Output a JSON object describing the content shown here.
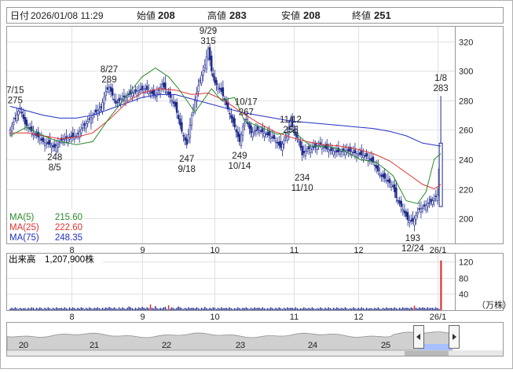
{
  "header": {
    "date_label": "日付",
    "date": "2026/01/08 11:29",
    "open_label": "始値",
    "open": "208",
    "high_label": "高値",
    "high": "283",
    "low_label": "安値",
    "low": "208",
    "close_label": "終値",
    "close": "251"
  },
  "colors": {
    "bull": "#ffffff",
    "bear": "#1e2a8c",
    "ma5": "#2a8a2a",
    "ma25": "#e03030",
    "ma75": "#2030c0",
    "high": "#e02020",
    "low": "#0a8a0a",
    "vol": "#1e2a8c",
    "vol_last": "#e02020"
  },
  "chart_data": {
    "type": "candlestick",
    "price_axis": {
      "ticks": [
        200,
        220,
        240,
        260,
        280,
        300,
        320
      ],
      "ylim": [
        183,
        330
      ]
    },
    "month_labels": [
      "8",
      "9",
      "10",
      "11",
      "12",
      "26/1"
    ],
    "annotations": [
      {
        "date": "7/15",
        "value": "275"
      },
      {
        "date": "8/5",
        "value": "248"
      },
      {
        "date": "8/27",
        "value": "289"
      },
      {
        "date": "9/18",
        "value": "247"
      },
      {
        "date": "9/29",
        "value": "315"
      },
      {
        "date": "10/14",
        "value": "249"
      },
      {
        "date": "10/17",
        "value": "267"
      },
      {
        "date": "11/10",
        "value": "234"
      },
      {
        "date": "11/12",
        "value": "255"
      },
      {
        "date": "12/24",
        "value": "193"
      },
      {
        "date": "1/8",
        "value": "283"
      }
    ],
    "ma_legend": [
      {
        "name": "MA(5)",
        "value": "215.60"
      },
      {
        "name": "MA(25)",
        "value": "222.60"
      },
      {
        "name": "MA(75)",
        "value": "248.35"
      }
    ],
    "ma5_points": [
      [
        0,
        256
      ],
      [
        10,
        262
      ],
      [
        20,
        256
      ],
      [
        27,
        253
      ],
      [
        40,
        250
      ],
      [
        50,
        252
      ],
      [
        60,
        268
      ],
      [
        72,
        285
      ],
      [
        80,
        296
      ],
      [
        88,
        302
      ],
      [
        96,
        296
      ],
      [
        102,
        288
      ],
      [
        112,
        272
      ],
      [
        122,
        288
      ],
      [
        128,
        280
      ],
      [
        136,
        282
      ],
      [
        142,
        266
      ],
      [
        152,
        262
      ],
      [
        162,
        257
      ],
      [
        172,
        259
      ],
      [
        182,
        249
      ],
      [
        192,
        249
      ],
      [
        202,
        246
      ],
      [
        212,
        240
      ],
      [
        222,
        238
      ],
      [
        232,
        229
      ],
      [
        240,
        212
      ],
      [
        247,
        210
      ],
      [
        252,
        218
      ],
      [
        257,
        240
      ],
      [
        261,
        244
      ]
    ],
    "ma25_points": [
      [
        0,
        258
      ],
      [
        10,
        258
      ],
      [
        20,
        256
      ],
      [
        30,
        254
      ],
      [
        40,
        255
      ],
      [
        50,
        258
      ],
      [
        60,
        267
      ],
      [
        72,
        280
      ],
      [
        80,
        285
      ],
      [
        90,
        288
      ],
      [
        100,
        287
      ],
      [
        110,
        284
      ],
      [
        120,
        285
      ],
      [
        130,
        280
      ],
      [
        140,
        272
      ],
      [
        150,
        265
      ],
      [
        160,
        259
      ],
      [
        170,
        255
      ],
      [
        180,
        252
      ],
      [
        190,
        250
      ],
      [
        200,
        249
      ],
      [
        210,
        247
      ],
      [
        220,
        244
      ],
      [
        230,
        239
      ],
      [
        240,
        231
      ],
      [
        250,
        223
      ],
      [
        257,
        220
      ],
      [
        261,
        223
      ]
    ],
    "ma75_points": [
      [
        0,
        276
      ],
      [
        10,
        273
      ],
      [
        20,
        270
      ],
      [
        30,
        268
      ],
      [
        40,
        268
      ],
      [
        50,
        270
      ],
      [
        60,
        274
      ],
      [
        70,
        278
      ],
      [
        80,
        282
      ],
      [
        90,
        284
      ],
      [
        100,
        284
      ],
      [
        110,
        281
      ],
      [
        120,
        278
      ],
      [
        130,
        275
      ],
      [
        140,
        272
      ],
      [
        150,
        270
      ],
      [
        160,
        268
      ],
      [
        170,
        266
      ],
      [
        180,
        265
      ],
      [
        190,
        264
      ],
      [
        200,
        263
      ],
      [
        210,
        262
      ],
      [
        220,
        261
      ],
      [
        230,
        259
      ],
      [
        240,
        256
      ],
      [
        250,
        251
      ],
      [
        261,
        249
      ]
    ],
    "volume_axis": {
      "ticks": [
        40,
        80,
        120
      ],
      "ylim": [
        0,
        135
      ],
      "unit": "（万株）"
    },
    "volume_label": "出来高",
    "volume_value": "1,207,900株",
    "volume": {
      "bars": [
        [
          0,
          4
        ],
        [
          8,
          5
        ],
        [
          14,
          6
        ],
        [
          22,
          4
        ],
        [
          30,
          5
        ],
        [
          36,
          7
        ],
        [
          44,
          6
        ],
        [
          52,
          5
        ],
        [
          60,
          8
        ],
        [
          66,
          7
        ],
        [
          72,
          9
        ],
        [
          80,
          8
        ],
        [
          85,
          14
        ],
        [
          88,
          10
        ],
        [
          94,
          8
        ],
        [
          96,
          12
        ],
        [
          102,
          9
        ],
        [
          110,
          6
        ],
        [
          118,
          8
        ],
        [
          124,
          6
        ],
        [
          130,
          5
        ],
        [
          136,
          5
        ],
        [
          142,
          5
        ],
        [
          150,
          6
        ],
        [
          156,
          5
        ],
        [
          162,
          4
        ],
        [
          170,
          6
        ],
        [
          176,
          5
        ],
        [
          180,
          4
        ],
        [
          186,
          5
        ],
        [
          192,
          4
        ],
        [
          200,
          4
        ],
        [
          206,
          5
        ],
        [
          212,
          4
        ],
        [
          218,
          5
        ],
        [
          224,
          4
        ],
        [
          230,
          5
        ],
        [
          236,
          6
        ],
        [
          240,
          6
        ],
        [
          245,
          11
        ],
        [
          250,
          7
        ],
        [
          255,
          6
        ],
        [
          261,
          122
        ]
      ]
    },
    "overview_dates": [
      "20",
      "21",
      "22",
      "23",
      "24",
      "25"
    ]
  }
}
